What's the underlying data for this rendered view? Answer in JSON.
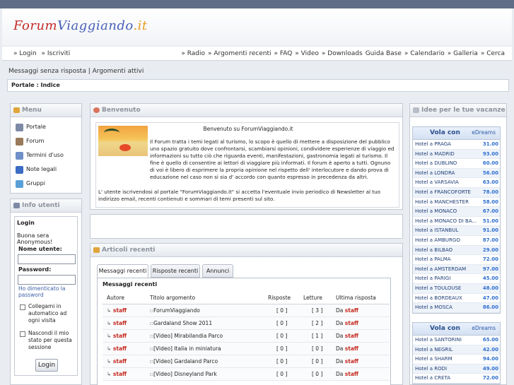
{
  "logo": {
    "part1": "Forum",
    "part2": "Viaggiando",
    "part3": ".it"
  },
  "nav": {
    "login": "» Login",
    "register": "» Iscriviti",
    "links": [
      "» Radio",
      "» Argomenti recenti",
      "» FAQ",
      "» Video",
      "» Downloads",
      "Guida Base",
      "» Calendario",
      "» Galleria",
      "» Cerca"
    ]
  },
  "sub": {
    "unanswered": "Messaggi senza risposta",
    "separator": " | ",
    "active": "Argomenti attivi"
  },
  "breadcrumb": {
    "portal": "Portale",
    "sep": " : ",
    "index": "Indice"
  },
  "menu": {
    "title": "Menu",
    "items": [
      "Portale",
      "Forum",
      "Termini d'uso",
      "Note legali",
      "Gruppi"
    ]
  },
  "info": {
    "title": "Info utenti",
    "login_title": "Login",
    "greeting": "Buona sera Anonymous!",
    "username_label": "Nome utente:",
    "password_label": "Password:",
    "forgot": "Ho dimenticato la password",
    "auto_login": "Collegami in automatico ad ogni visita",
    "hide_status": "Nascondi il mio stato per questa sessione",
    "login_button": "Login"
  },
  "welcome": {
    "title": "Benvenuto",
    "heading": "Benvenuto su ForumViaggiando.it",
    "text": "Il Forum tratta i temi legati al turismo, lo scopo è quello di mettere a disposizione del pubblico uno spazio gratuito dove confrontarsi, scambiarsi opinioni, condividere esperienze di viaggio ed informazioni su tutto ciò che riguarda eventi, manifestazioni, gastronomia legati al turismo. Il fine è quello di consentire ai lettori di viaggiare più informati. Il forum è aperto a tutti. Ognuno di voi è libero di esprimere la propria opinione nel rispetto dell' interlocutore e dando prova di educazione nel caso non si sia d' accordo con quanto espresso in precedenza da altri.",
    "text2": "L' utente iscrivendosi al portale \"ForumViaggiando.it\" si accetta l'eventuale invio periodico di Newsletter al tuo indirizzo email, recenti contienuti e sommari di temi presenti sul sito."
  },
  "recent": {
    "title": "Articoli recenti",
    "tabs": [
      "Messaggi recenti",
      "Risposte recenti",
      "Annunci"
    ],
    "section": "Messaggi recenti",
    "headers": [
      "Autore",
      "Titolo argomento",
      "Risposte",
      "Letture",
      "Ultima risposta"
    ],
    "rows": [
      {
        "author": "staff",
        "title": "ForumViaggiando",
        "replies": "[ 0 ]",
        "reads": "[ 3 ]",
        "last": "Da",
        "last_author": "staff"
      },
      {
        "author": "staff",
        "title": "Gardaland Show 2011",
        "replies": "[ 0 ]",
        "reads": "[ 2 ]",
        "last": "Da",
        "last_author": "staff"
      },
      {
        "author": "staff",
        "title": "[Video] Mirabilandia Parco",
        "replies": "[ 0 ]",
        "reads": "[ 1 ]",
        "last": "Da",
        "last_author": "staff"
      },
      {
        "author": "staff",
        "title": "[Video] Italia in miniatura",
        "replies": "[ 0 ]",
        "reads": "[ 0 ]",
        "last": "Da",
        "last_author": "staff"
      },
      {
        "author": "staff",
        "title": "[Video] Gardaland Parco",
        "replies": "[ 0 ]",
        "reads": "[ 0 ]",
        "last": "Da",
        "last_author": "staff"
      },
      {
        "author": "staff",
        "title": "[Video] Disneyland Park",
        "replies": "[ 0 ]",
        "reads": "[ 0 ]",
        "last": "Da",
        "last_author": "staff"
      }
    ]
  },
  "ideas": {
    "title": "Idee per le tue vacanze",
    "brand": "eDreams",
    "deal1": {
      "title": "Vola con",
      "rows": [
        {
          "n": "Hotel a PRAGA",
          "p": "31.00"
        },
        {
          "n": "Hotel a MADRID",
          "p": "93.00"
        },
        {
          "n": "Hotel a DUBLINO",
          "p": "60.00"
        },
        {
          "n": "Hotel a LONDRA",
          "p": "56.00"
        },
        {
          "n": "Hotel a VARSAVIA",
          "p": "63.00"
        },
        {
          "n": "Hotel a FRANCOFORTE",
          "p": "78.00"
        },
        {
          "n": "Hotel a MANCHESTER",
          "p": "58.00"
        },
        {
          "n": "Hotel a MONACO",
          "p": "67.00"
        },
        {
          "n": "Hotel a MONACO DI BA...",
          "p": "51.00"
        },
        {
          "n": "Hotel a ISTANBUL",
          "p": "91.00"
        },
        {
          "n": "Hotel a AMBURGO",
          "p": "87.00"
        },
        {
          "n": "Hotel a BILBAO",
          "p": "29.00"
        },
        {
          "n": "Hotel a PALMA",
          "p": "72.00"
        },
        {
          "n": "Hotel a AMSTERDAM",
          "p": "97.00"
        },
        {
          "n": "Hotel a PARIGI",
          "p": "45.00"
        },
        {
          "n": "Hotel a TOULOUSE",
          "p": "48.00"
        },
        {
          "n": "Hotel a BORDEAUX",
          "p": "47.00"
        },
        {
          "n": "Hotel a MOSCA",
          "p": "86.00"
        }
      ]
    },
    "deal2": {
      "title": "Vola con",
      "rows": [
        {
          "n": "Hotel a SANTORINI",
          "p": "65.00"
        },
        {
          "n": "Hotel a NEGRIL",
          "p": "42.00"
        },
        {
          "n": "Hotel a SHARM",
          "p": "94.00"
        },
        {
          "n": "Hotel a RODI",
          "p": "49.00"
        },
        {
          "n": "Hotel a CRETA",
          "p": "72.00"
        }
      ]
    }
  },
  "colors": {
    "header_bar": "#5f6d86",
    "link_red": "#c3281e",
    "price_blue": "#2e6fd0"
  }
}
